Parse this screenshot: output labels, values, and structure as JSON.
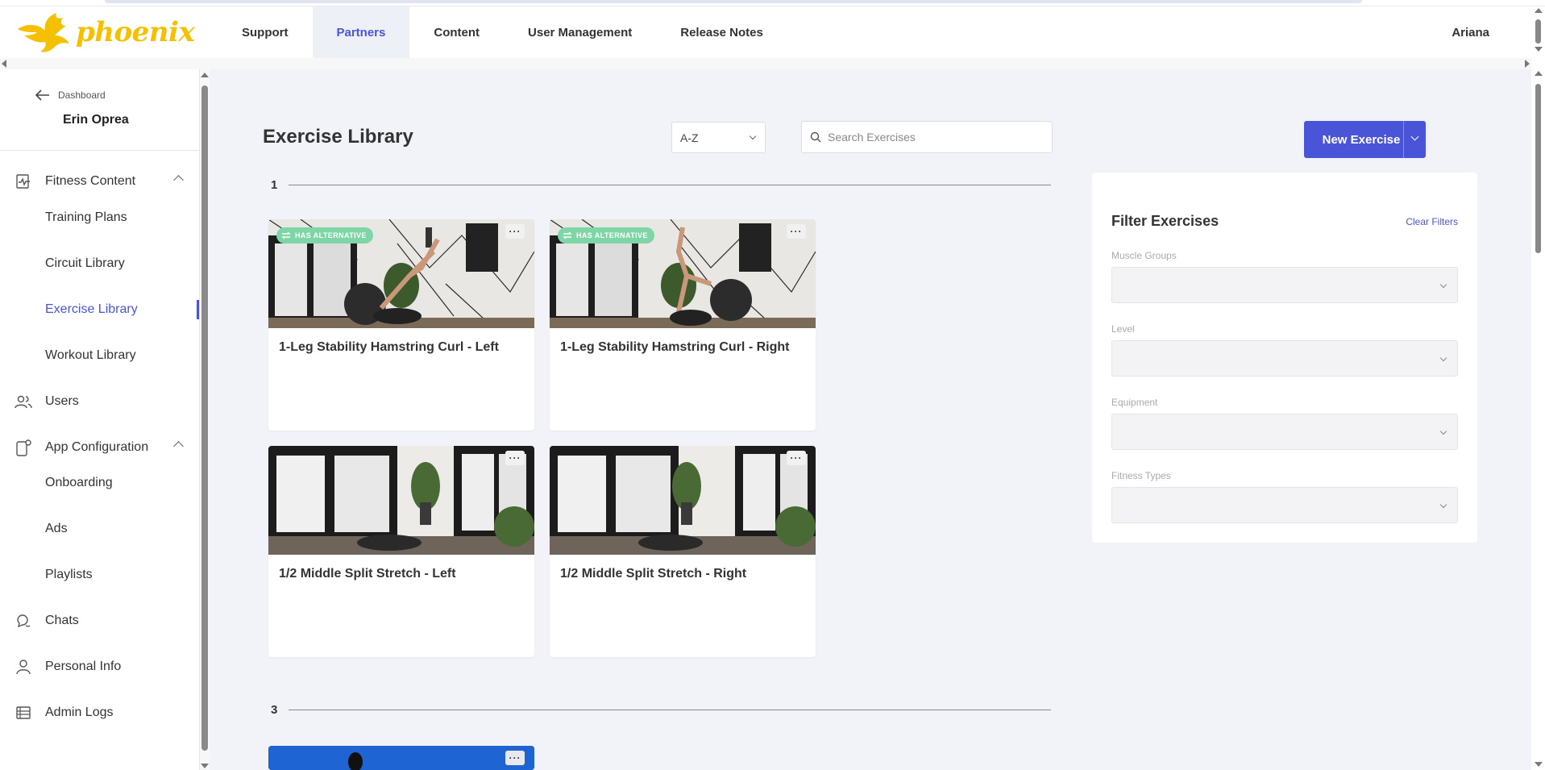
{
  "app": {
    "logo_text": "phoenix",
    "brand_color": "#f5c000",
    "accent_color": "#4a54d8"
  },
  "nav": {
    "items": [
      {
        "label": "Support"
      },
      {
        "label": "Partners",
        "active": true
      },
      {
        "label": "Content"
      },
      {
        "label": "User Management"
      },
      {
        "label": "Release Notes"
      }
    ],
    "user": "Ariana"
  },
  "sidebar": {
    "back_label": "Dashboard",
    "user_name": "Erin Oprea",
    "groups": {
      "fitness": {
        "label": "Fitness Content",
        "icon": "activity-icon",
        "sub": [
          "Training Plans",
          "Circuit Library",
          "Exercise Library",
          "Workout Library"
        ],
        "active_sub": "Exercise Library"
      },
      "users": {
        "label": "Users",
        "icon": "users-icon"
      },
      "app_config": {
        "label": "App Configuration",
        "icon": "device-settings-icon",
        "sub": [
          "Onboarding",
          "Ads",
          "Playlists"
        ]
      },
      "chats": {
        "label": "Chats",
        "icon": "chat-icon"
      },
      "personal": {
        "label": "Personal Info",
        "icon": "person-icon"
      },
      "logs": {
        "label": "Admin Logs",
        "icon": "list-icon"
      }
    }
  },
  "main": {
    "title": "Exercise Library",
    "sort_value": "A-Z",
    "search_placeholder": "Search Exercises",
    "new_button": "New Exercise",
    "sections": [
      {
        "heading": "1",
        "cards": [
          {
            "title": "1-Leg Stability Hamstring Curl - Left",
            "badge": "HAS ALTERNATIVE",
            "more": "···"
          },
          {
            "title": "1-Leg Stability Hamstring Curl - Right",
            "badge": "HAS ALTERNATIVE",
            "more": "···"
          },
          {
            "title": "1/2 Middle Split Stretch - Left",
            "more": "···"
          },
          {
            "title": "1/2 Middle Split Stretch - Right",
            "more": "···"
          }
        ]
      },
      {
        "heading": "3",
        "cards": [
          {
            "more": "···"
          }
        ]
      }
    ]
  },
  "filters": {
    "title": "Filter Exercises",
    "clear_label": "Clear Filters",
    "fields": [
      {
        "label": "Muscle Groups",
        "value": ""
      },
      {
        "label": "Level",
        "value": ""
      },
      {
        "label": "Equipment",
        "value": ""
      },
      {
        "label": "Fitness Types",
        "value": ""
      }
    ]
  }
}
